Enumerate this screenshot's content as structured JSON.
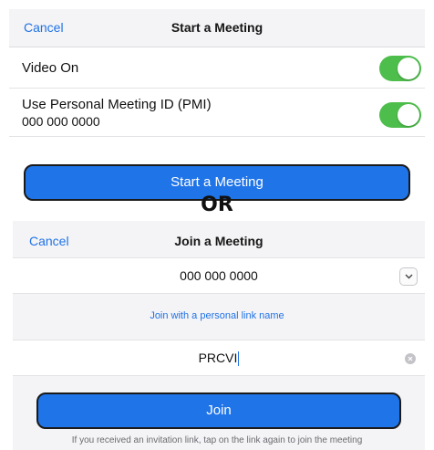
{
  "start_meeting": {
    "nav": {
      "cancel_label": "Cancel",
      "title": "Start a Meeting"
    },
    "video_on": {
      "label": "Video On",
      "enabled": true
    },
    "pmi": {
      "label": "Use Personal Meeting ID (PMI)",
      "meeting_id": "000 000 0000",
      "enabled": true
    },
    "start_button_label": "Start a Meeting"
  },
  "separator_text": "OR",
  "join_meeting": {
    "nav": {
      "cancel_label": "Cancel",
      "title": "Join a Meeting"
    },
    "meeting_id_value": "000 000 0000",
    "personal_link_label": "Join with a personal link name",
    "name_value": "PRCVI",
    "join_button_label": "Join",
    "hint_text": "If you received an invitation link, tap on the link again to join the meeting"
  },
  "colors": {
    "accent": "#1f72e6",
    "button_blue": "#1f74e8",
    "toggle_green": "#4dbe4b",
    "nav_bg": "#f4f4f6"
  },
  "icons": {
    "dropdown": "chevron-down-icon",
    "clear": "clear-icon"
  }
}
